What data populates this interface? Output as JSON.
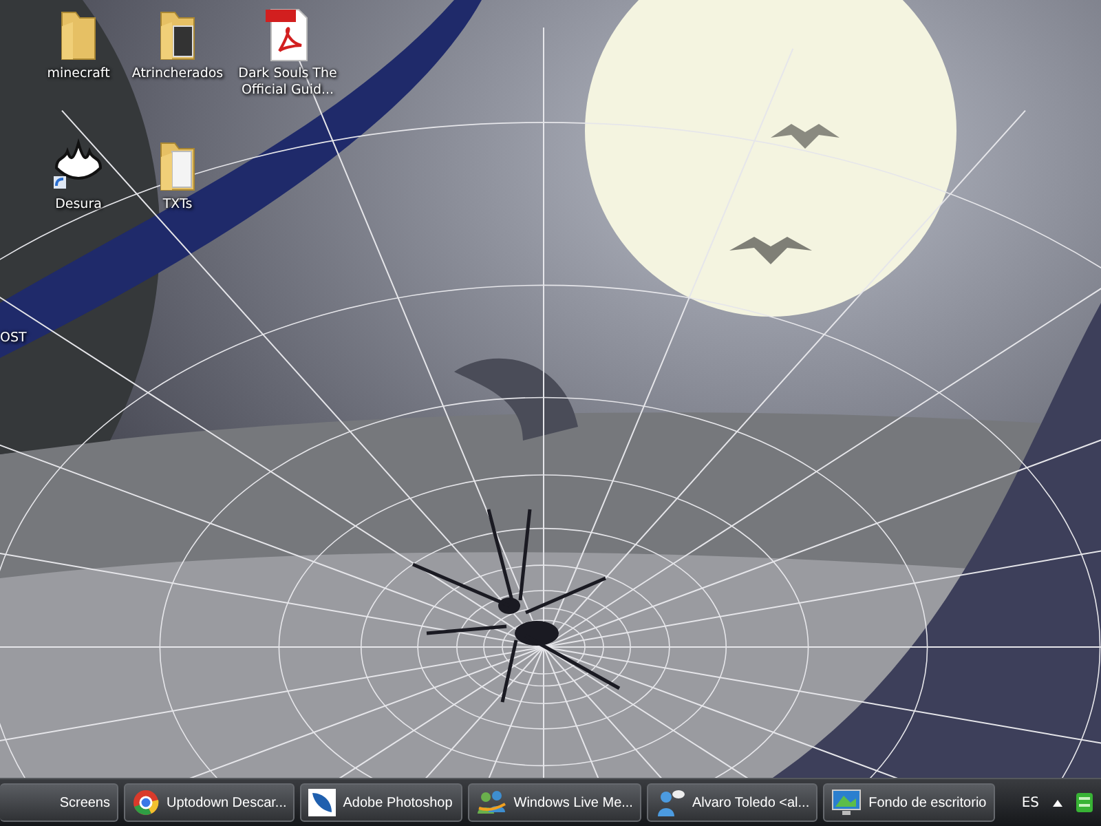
{
  "desktop_icons": [
    {
      "label": "minecraft",
      "kind": "folder"
    },
    {
      "label": "Atrincherados",
      "kind": "photo-folder"
    },
    {
      "label": "Dark Souls The Official Guid...",
      "kind": "pdf"
    },
    {
      "label": "Desura",
      "kind": "shortcut"
    },
    {
      "label": "TXTs",
      "kind": "doc-folder"
    },
    {
      "label": "OST",
      "kind": "cut"
    }
  ],
  "taskbar": {
    "buttons": [
      {
        "label": "Screens",
        "kind": "none"
      },
      {
        "label": "Uptodown Descar...",
        "kind": "browser"
      },
      {
        "label": "Adobe Photoshop",
        "kind": "feather"
      },
      {
        "label": "Windows Live Me...",
        "kind": "people"
      },
      {
        "label": "Alvaro Toledo <al...",
        "kind": "person"
      },
      {
        "label": "Fondo de escritorio",
        "kind": "monitor"
      }
    ],
    "language": "ES"
  }
}
